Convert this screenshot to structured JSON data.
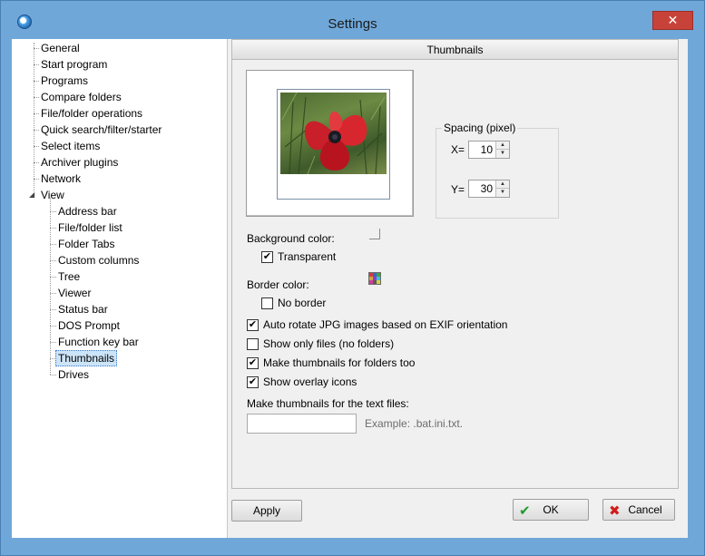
{
  "window": {
    "title": "Settings",
    "close_label": "✕"
  },
  "tree": {
    "items": [
      {
        "label": "General",
        "level": 0
      },
      {
        "label": "Start program",
        "level": 0
      },
      {
        "label": "Programs",
        "level": 0
      },
      {
        "label": "Compare folders",
        "level": 0
      },
      {
        "label": "File/folder operations",
        "level": 0
      },
      {
        "label": "Quick search/filter/starter",
        "level": 0
      },
      {
        "label": "Select items",
        "level": 0
      },
      {
        "label": "Archiver plugins",
        "level": 0
      },
      {
        "label": "Network",
        "level": 0
      },
      {
        "label": "View",
        "level": 0,
        "expanded": true
      },
      {
        "label": "Address bar",
        "level": 1
      },
      {
        "label": "File/folder list",
        "level": 1
      },
      {
        "label": "Folder Tabs",
        "level": 1
      },
      {
        "label": "Custom columns",
        "level": 1
      },
      {
        "label": "Tree",
        "level": 1
      },
      {
        "label": "Viewer",
        "level": 1
      },
      {
        "label": "Status bar",
        "level": 1
      },
      {
        "label": "DOS Prompt",
        "level": 1
      },
      {
        "label": "Function key bar",
        "level": 1
      },
      {
        "label": "Thumbnails",
        "level": 1,
        "selected": true
      },
      {
        "label": "Drives",
        "level": 1
      }
    ],
    "expander_glyph": "◢"
  },
  "panel": {
    "header": "Thumbnails",
    "spacing": {
      "group_label": "Spacing (pixel)",
      "x_label": "X=",
      "x_value": "10",
      "y_label": "Y=",
      "y_value": "30"
    },
    "background_color": {
      "label": "Background color:",
      "transparent_label": "Transparent",
      "transparent_checked": true
    },
    "border_color": {
      "label": "Border color:",
      "no_border_label": "No border",
      "no_border_checked": false,
      "swatch_colors": [
        "#d23b3b",
        "#3b62d2",
        "#3ba83b",
        "#d2a23b",
        "#8a3bd2",
        "#3bc4d2",
        "#d23b9a",
        "#5a5a5a",
        "#d2d23b"
      ]
    },
    "options": [
      {
        "label": "Auto rotate JPG images based on EXIF orientation",
        "checked": true
      },
      {
        "label": "Show only files (no folders)",
        "checked": false
      },
      {
        "label": "Make thumbnails for folders too",
        "checked": true
      },
      {
        "label": "Show overlay icons",
        "checked": true
      }
    ],
    "text_files": {
      "label": "Make thumbnails for the text files:",
      "value": "",
      "example": "Example: .bat.ini.txt."
    }
  },
  "buttons": {
    "apply": "Apply",
    "ok": "OK",
    "cancel": "Cancel",
    "ok_icon": "✔",
    "cancel_icon": "✖"
  },
  "check_glyph": "✔",
  "colors": {
    "ok_green": "#1f9a2f",
    "cancel_red": "#d11c1c",
    "selection": "#cce4f7"
  }
}
